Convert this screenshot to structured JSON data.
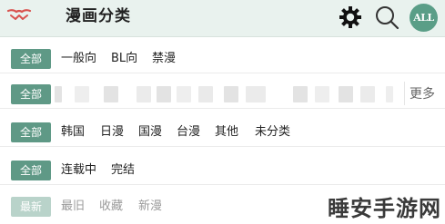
{
  "header": {
    "title": "漫画分类",
    "avatar_text": "ALL",
    "accent_color": "#5f9986",
    "header_bg": "#e9f2ee",
    "icons": [
      "logo-icon",
      "gear-icon",
      "search-icon"
    ]
  },
  "filters": {
    "row1": {
      "tag": "全部",
      "options": [
        "一般向",
        "BL向",
        "禁漫"
      ]
    },
    "row2": {
      "tag": "全部",
      "more": "更多"
    },
    "row3": {
      "tag": "全部",
      "options": [
        "韩国",
        "日漫",
        "国漫",
        "台漫",
        "其他",
        "未分类"
      ]
    },
    "row4": {
      "tag": "全部",
      "options": [
        "连载中",
        "完结"
      ]
    },
    "row5": {
      "tag": "最新",
      "options": [
        "最旧",
        "收藏",
        "新漫"
      ]
    }
  },
  "watermark": "睡安手游网"
}
